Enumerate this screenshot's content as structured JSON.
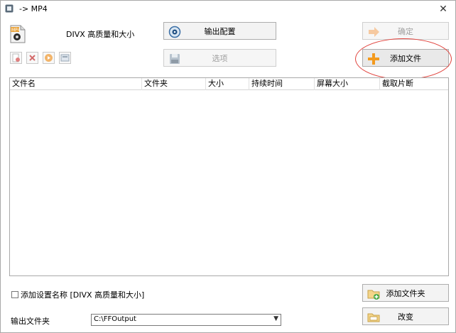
{
  "window": {
    "title": "-> MP4",
    "close_glyph": "✕"
  },
  "format": {
    "icon": "mp4-file-icon",
    "icon_text": "MP4"
  },
  "profile": {
    "label": "DIVX 高质量和大小"
  },
  "toolbar": {
    "output_config": "输出配置",
    "options": "选项",
    "ok": "确定",
    "add_file": "添加文件",
    "add_folder": "添加文件夹",
    "change": "改变"
  },
  "file_table": {
    "columns": [
      "文件名",
      "文件夹",
      "大小",
      "持续时间",
      "屏幕大小",
      "截取片断"
    ],
    "rows": []
  },
  "footer": {
    "add_name_checkbox": "添加设置名称 [DIVX 高质量和大小]",
    "add_name_checked": false,
    "output_folder_label": "输出文件夹",
    "output_folder_value": "C:\\FFOutput"
  },
  "colors": {
    "accent_orange": "#f39a1e",
    "highlight_red": "#e0423c"
  }
}
